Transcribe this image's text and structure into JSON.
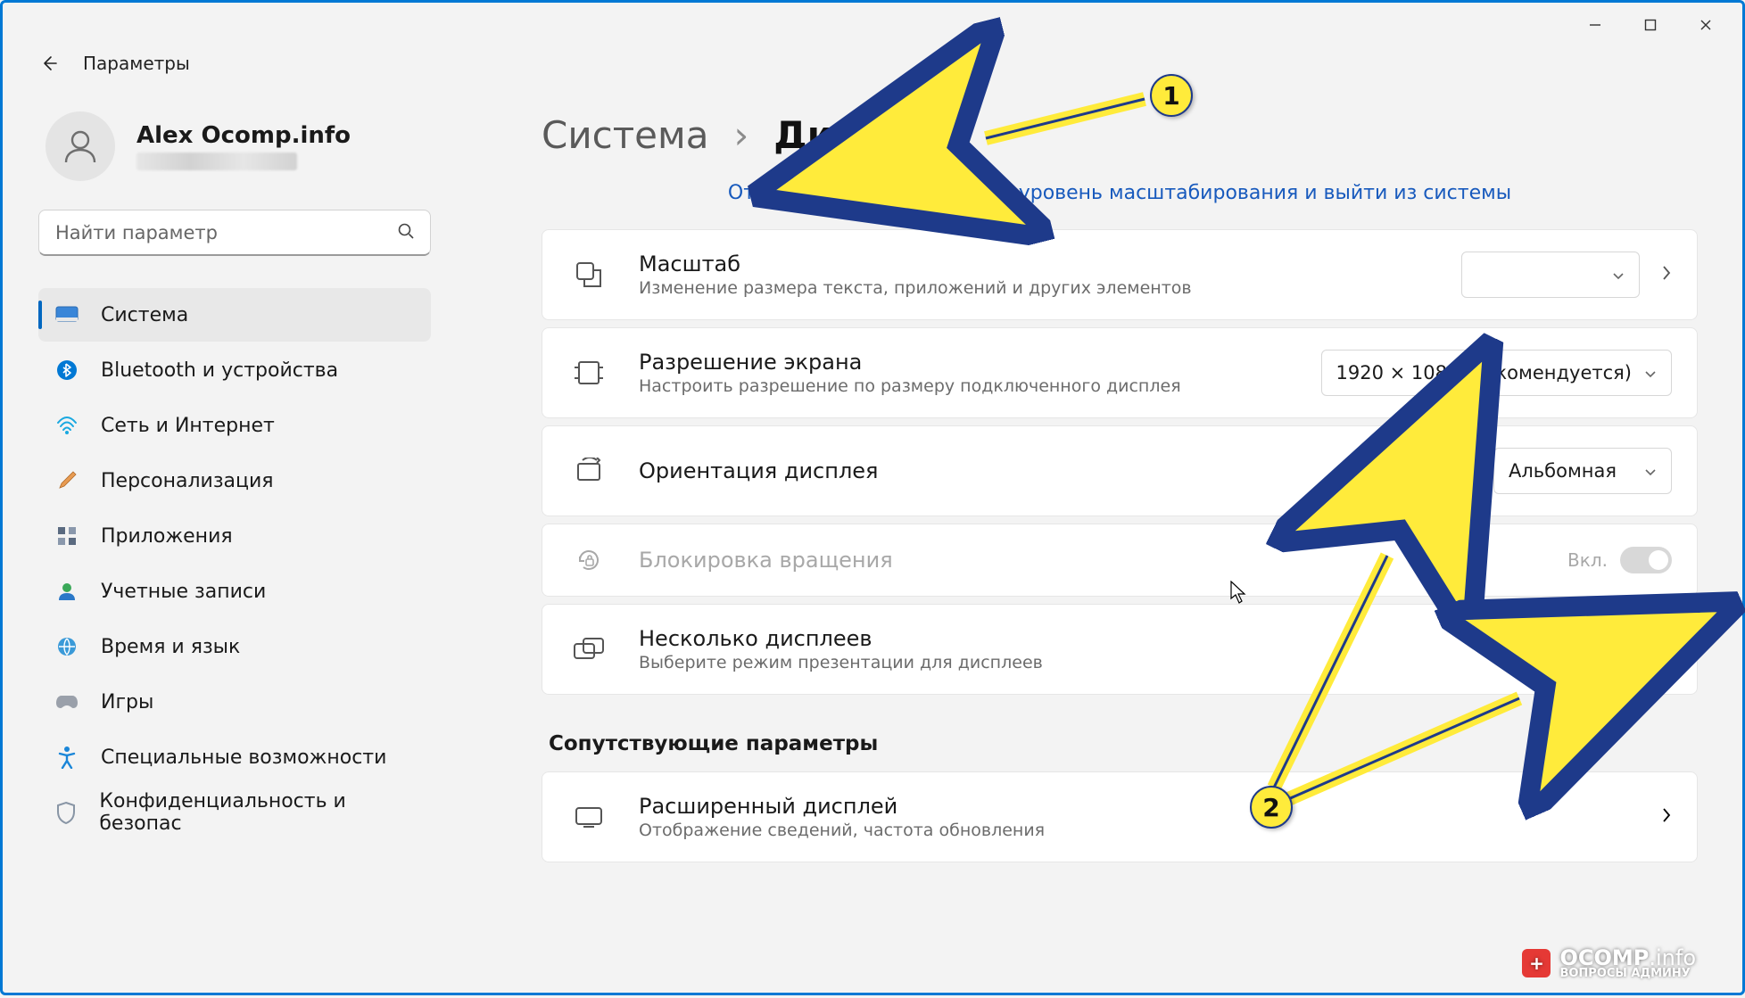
{
  "window": {
    "app_title": "Параметры"
  },
  "profile": {
    "name": "Alex Ocomp.info"
  },
  "search": {
    "placeholder": "Найти параметр"
  },
  "nav": {
    "items": [
      {
        "label": "Система"
      },
      {
        "label": "Bluetooth и устройства"
      },
      {
        "label": "Сеть и Интернет"
      },
      {
        "label": "Персонализация"
      },
      {
        "label": "Приложения"
      },
      {
        "label": "Учетные записи"
      },
      {
        "label": "Время и язык"
      },
      {
        "label": "Игры"
      },
      {
        "label": "Специальные возможности"
      },
      {
        "label": "Конфиденциальность и безопас"
      }
    ],
    "active_index": 0
  },
  "breadcrumb": {
    "root": "Система",
    "current": "Дисплей"
  },
  "link_banner": "Отключить настраиваемый уровень масштабирования и выйти из системы",
  "cards": {
    "scale": {
      "title": "Масштаб",
      "desc": "Изменение размера текста, приложений и других элементов",
      "value": ""
    },
    "resolution": {
      "title": "Разрешение экрана",
      "desc": "Настроить  разрешение  по  размеру  подключенного  дисплея",
      "value": "1920 × 1080 (рекомендуется)"
    },
    "orientation": {
      "title": "Ориентация дисплея",
      "value": "Альбомная"
    },
    "rotation_lock": {
      "title": "Блокировка вращения",
      "state_label": "Вкл."
    },
    "multiple": {
      "title": "Несколько дисплеев",
      "desc": "Выберите режим презентации для дисплеев"
    },
    "advanced": {
      "title": "Расширенный дисплей",
      "desc": "Отображение сведений, частота обновления"
    }
  },
  "related_header": "Сопутствующие параметры",
  "annotations": {
    "one": "1",
    "two": "2"
  },
  "watermark": {
    "brand": "OCOMP",
    "tld": ".info",
    "sub": "ВОПРОСЫ АДМИНУ"
  }
}
